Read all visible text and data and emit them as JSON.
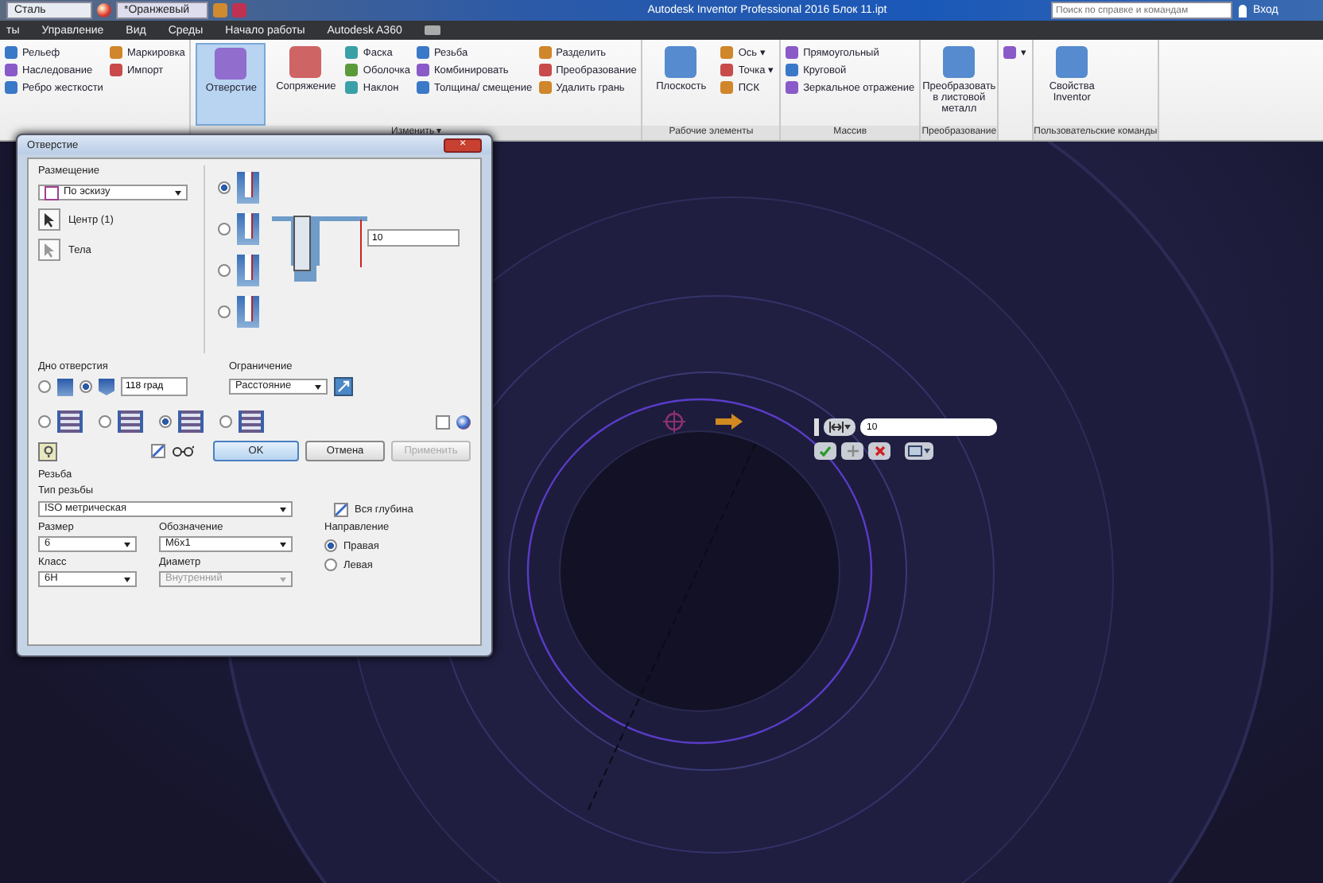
{
  "quick_access": {
    "material": "Сталь",
    "appearance": "*Оранжевый"
  },
  "title": "Autodesk Inventor Professional 2016   Блок 11.ipt",
  "search": {
    "placeholder": "Поиск по справке и командам"
  },
  "sign_in": "Вход",
  "ribbon_tabs": [
    "ты",
    "Управление",
    "Вид",
    "Среды",
    "Начало работы",
    "Autodesk A360"
  ],
  "ribbon_groups": [
    {
      "columns": [
        {
          "kind": "small",
          "items": [
            "Рельеф",
            "Наследование",
            "Ребро жесткости"
          ]
        },
        {
          "kind": "small",
          "items": [
            "Маркировка",
            "Импорт"
          ]
        }
      ]
    },
    {
      "label": "Изменить ▾",
      "columns": [
        {
          "kind": "large",
          "label": "Отверстие",
          "selected": true
        },
        {
          "kind": "large",
          "label": "Сопряжение",
          "selected": false
        },
        {
          "kind": "small",
          "items": [
            "Фаска",
            "Оболочка",
            "Наклон"
          ]
        },
        {
          "kind": "small",
          "items": [
            "Резьба",
            "Комбинировать",
            "Толщина/ смещение"
          ]
        },
        {
          "kind": "small",
          "items": [
            "Разделить",
            "Преобразование",
            "Удалить грань"
          ]
        }
      ]
    },
    {
      "label": "Рабочие элементы",
      "columns": [
        {
          "kind": "large",
          "label": "Плоскость",
          "selected": false
        },
        {
          "kind": "small",
          "items": [
            "Ось ▾",
            "Точка ▾",
            "ПСК"
          ]
        }
      ]
    },
    {
      "label": "Массив",
      "columns": [
        {
          "kind": "small",
          "items": [
            "Прямоугольный",
            "Круговой",
            "Зеркальное отражение"
          ]
        }
      ]
    },
    {
      "label": "Преобразование",
      "columns": [
        {
          "kind": "large",
          "label": "Преобразовать в листовой металл",
          "selected": false
        }
      ]
    },
    {
      "columns": [
        {
          "kind": "small",
          "items": [
            "▾"
          ]
        }
      ]
    },
    {
      "label": "Пользовательские команды",
      "columns": [
        {
          "kind": "large",
          "label": "Свойства Inventor",
          "selected": false
        }
      ]
    }
  ],
  "dialog": {
    "title": "Отверстие",
    "close": "×",
    "placement_label": "Размещение",
    "placement_value": "По эскизу",
    "centers": "Центр (1)",
    "solids": "Тела",
    "hole_types": [
      {
        "selected": true
      },
      {
        "selected": false
      },
      {
        "selected": false
      },
      {
        "selected": false
      }
    ],
    "depth_value": "10",
    "drill_point_label": "Дно отверстия",
    "drill_points": [
      {
        "selected": false
      },
      {
        "selected": true
      }
    ],
    "drill_angle": "118 град",
    "termination_label": "Ограничение",
    "termination_value": "Расстояние",
    "thread_forms": [
      {
        "selected": false
      },
      {
        "selected": false
      },
      {
        "selected": true
      },
      {
        "selected": false
      }
    ],
    "flip_check": {
      "checked": false
    },
    "infer_check": {
      "checked": true
    },
    "buttons": [
      {
        "label": "OK",
        "disabled": false
      },
      {
        "label": "Отмена",
        "disabled": false
      },
      {
        "label": "Применить",
        "disabled": true
      }
    ],
    "threads_label": "Резьба",
    "thread_type_label": "Тип резьбы",
    "thread_type_value": "ISO метрическая",
    "full_depth": {
      "label": "Вся глубина",
      "checked": true
    },
    "size_label": "Размер",
    "size_value": "6",
    "designation_label": "Обозначение",
    "designation_value": "M6x1",
    "direction_label": "Направление",
    "directions": [
      {
        "label": "Правая",
        "selected": true
      },
      {
        "label": "Левая",
        "selected": false
      }
    ],
    "class_label": "Класс",
    "class_value": "6H",
    "diameter_label": "Диаметр",
    "diameter_value": "Внутренний",
    "diameter_disabled": true
  },
  "mini_toolbar": {
    "value": "10"
  }
}
